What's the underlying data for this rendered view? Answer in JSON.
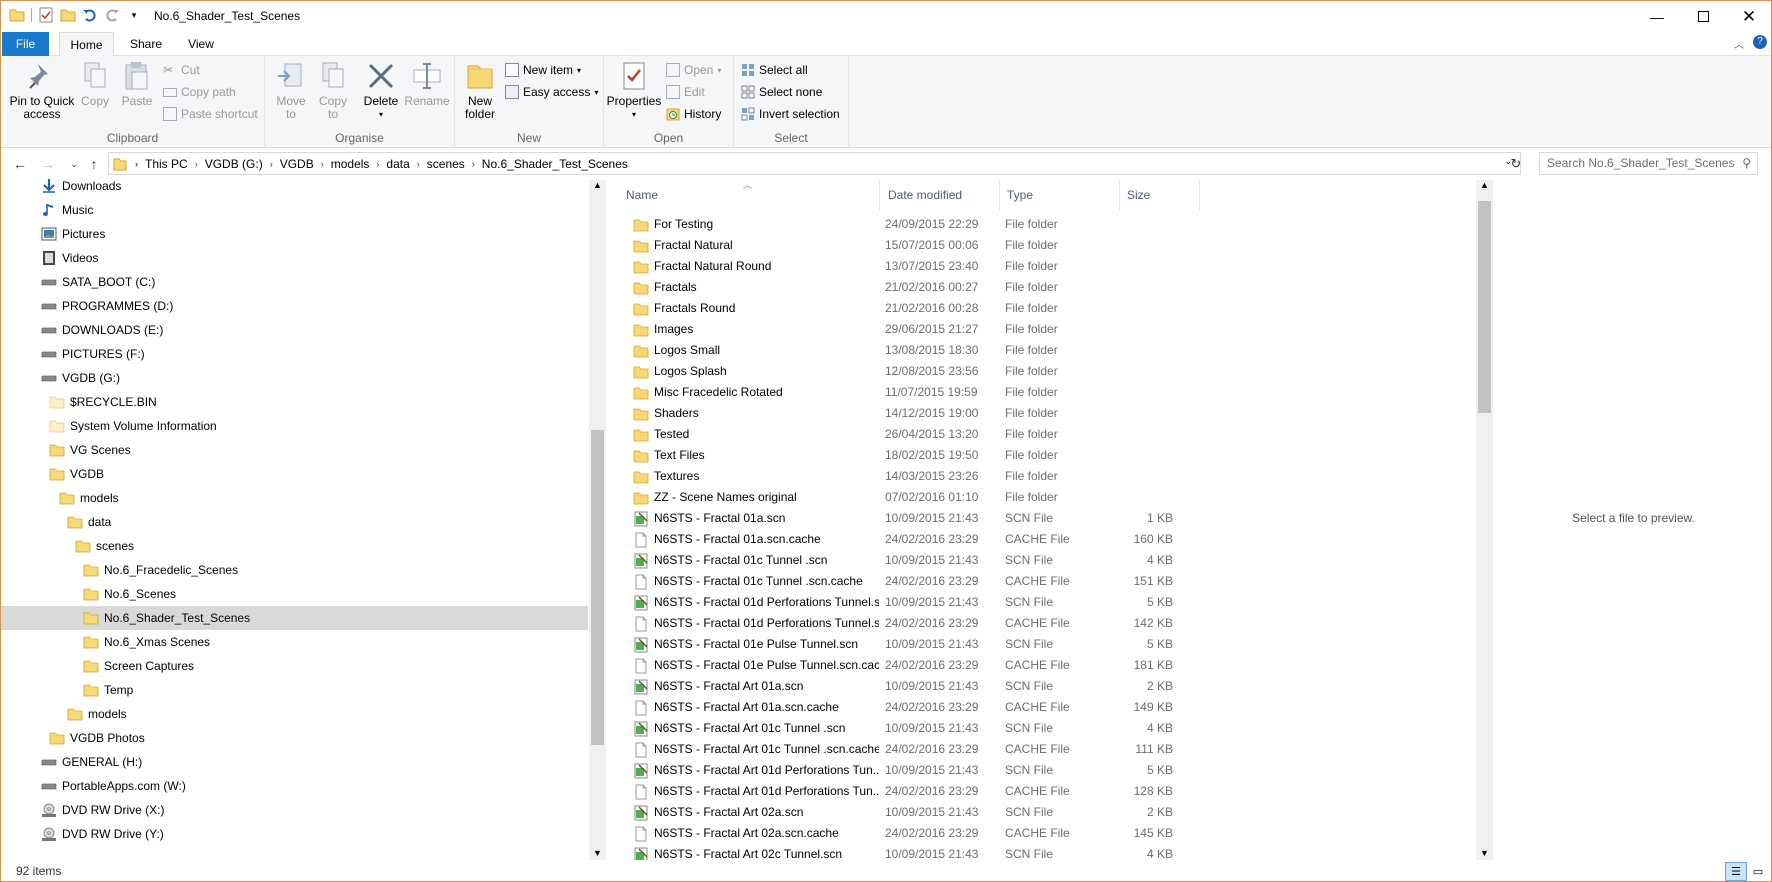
{
  "window": {
    "title": "No.6_Shader_Test_Scenes",
    "controls": [
      "minimize",
      "maximize",
      "close"
    ]
  },
  "quick_access_toolbar": {
    "icons": [
      "folder-icon",
      "properties-check-icon",
      "new-folder-icon",
      "undo-icon",
      "redo-icon",
      "customize-dropdown-icon"
    ]
  },
  "ribbon": {
    "tabs": [
      {
        "label": "File"
      },
      {
        "label": "Home"
      },
      {
        "label": "Share"
      },
      {
        "label": "View"
      }
    ],
    "active_tab": "Home",
    "groups": {
      "clipboard": {
        "label": "Clipboard",
        "pin_label": "Pin to Quick access",
        "pin_line1": "Pin to Quick",
        "pin_line2": "access",
        "copy_label": "Copy",
        "paste_label": "Paste",
        "cut_label": "Cut",
        "copy_path_label": "Copy path",
        "paste_shortcut_label": "Paste shortcut"
      },
      "organise": {
        "label": "Organise",
        "move_to_line1": "Move",
        "move_to_line2": "to",
        "copy_to_line1": "Copy",
        "copy_to_line2": "to",
        "delete_label": "Delete",
        "rename_label": "Rename"
      },
      "new": {
        "label": "New",
        "new_folder_line1": "New",
        "new_folder_line2": "folder",
        "new_item_label": "New item",
        "easy_access_label": "Easy access"
      },
      "open": {
        "label": "Open",
        "properties_label": "Properties",
        "open_label": "Open",
        "edit_label": "Edit",
        "history_label": "History"
      },
      "select": {
        "label": "Select",
        "select_all_label": "Select all",
        "select_none_label": "Select none",
        "invert_label": "Invert selection"
      }
    }
  },
  "address_bar": {
    "breadcrumbs": [
      "This PC",
      "VGDB (G:)",
      "VGDB",
      "models",
      "data",
      "scenes",
      "No.6_Shader_Test_Scenes"
    ],
    "search_placeholder": "Search No.6_Shader_Test_Scenes"
  },
  "nav_pane": {
    "items": [
      {
        "label": "Downloads",
        "icon": "downloads-icon",
        "level": 0
      },
      {
        "label": "Music",
        "icon": "music-icon",
        "level": 0
      },
      {
        "label": "Pictures",
        "icon": "pictures-icon",
        "level": 0
      },
      {
        "label": "Videos",
        "icon": "videos-icon",
        "level": 0
      },
      {
        "label": "SATA_BOOT (C:)",
        "icon": "drive-icon",
        "level": 0
      },
      {
        "label": "PROGRAMMES (D:)",
        "icon": "drive-icon",
        "level": 0
      },
      {
        "label": "DOWNLOADS (E:)",
        "icon": "drive-icon",
        "level": 0
      },
      {
        "label": "PICTURES (F:)",
        "icon": "drive-icon",
        "level": 0
      },
      {
        "label": "VGDB (G:)",
        "icon": "drive-icon",
        "level": 0
      },
      {
        "label": "$RECYCLE.BIN",
        "icon": "folder-pale-icon",
        "level": 1
      },
      {
        "label": "System Volume Information",
        "icon": "folder-pale-icon",
        "level": 1
      },
      {
        "label": "VG Scenes",
        "icon": "folder-icon",
        "level": 1
      },
      {
        "label": "VGDB",
        "icon": "folder-icon",
        "level": 1
      },
      {
        "label": "models",
        "icon": "folder-icon",
        "level": 2
      },
      {
        "label": "data",
        "icon": "folder-icon",
        "level": 3
      },
      {
        "label": "scenes",
        "icon": "folder-icon",
        "level": 4
      },
      {
        "label": "No.6_Fracedelic_Scenes",
        "icon": "folder-icon",
        "level": 5
      },
      {
        "label": "No.6_Scenes",
        "icon": "folder-icon",
        "level": 5
      },
      {
        "label": "No.6_Shader_Test_Scenes",
        "icon": "folder-icon",
        "level": 5,
        "selected": true
      },
      {
        "label": "No.6_Xmas Scenes",
        "icon": "folder-icon",
        "level": 5
      },
      {
        "label": "Screen Captures",
        "icon": "folder-icon",
        "level": 5
      },
      {
        "label": "Temp",
        "icon": "folder-icon",
        "level": 5
      },
      {
        "label": "models",
        "icon": "folder-icon",
        "level": 3
      },
      {
        "label": "VGDB Photos",
        "icon": "folder-icon",
        "level": 1
      },
      {
        "label": "GENERAL (H:)",
        "icon": "drive-icon",
        "level": 0
      },
      {
        "label": "PortableApps.com (W:)",
        "icon": "drive-icon",
        "level": 0
      },
      {
        "label": "DVD RW Drive (X:)",
        "icon": "dvd-icon",
        "level": 0
      },
      {
        "label": "DVD RW Drive (Y:)",
        "icon": "dvd-icon",
        "level": 0
      }
    ]
  },
  "file_list": {
    "columns": {
      "name": "Name",
      "date": "Date modified",
      "type": "Type",
      "size": "Size"
    },
    "rows": [
      {
        "name": "For Testing",
        "date": "24/09/2015 22:29",
        "type": "File folder",
        "size": "",
        "icon": "folder"
      },
      {
        "name": "Fractal Natural",
        "date": "15/07/2015 00:06",
        "type": "File folder",
        "size": "",
        "icon": "folder"
      },
      {
        "name": "Fractal Natural Round",
        "date": "13/07/2015 23:40",
        "type": "File folder",
        "size": "",
        "icon": "folder"
      },
      {
        "name": "Fractals",
        "date": "21/02/2016 00:27",
        "type": "File folder",
        "size": "",
        "icon": "folder"
      },
      {
        "name": "Fractals Round",
        "date": "21/02/2016 00:28",
        "type": "File folder",
        "size": "",
        "icon": "folder"
      },
      {
        "name": "Images",
        "date": "29/06/2015 21:27",
        "type": "File folder",
        "size": "",
        "icon": "folder"
      },
      {
        "name": "Logos Small",
        "date": "13/08/2015 18:30",
        "type": "File folder",
        "size": "",
        "icon": "folder"
      },
      {
        "name": "Logos Splash",
        "date": "12/08/2015 23:56",
        "type": "File folder",
        "size": "",
        "icon": "folder"
      },
      {
        "name": "Misc Fracedelic Rotated",
        "date": "11/07/2015 19:59",
        "type": "File folder",
        "size": "",
        "icon": "folder"
      },
      {
        "name": "Shaders",
        "date": "14/12/2015 19:00",
        "type": "File folder",
        "size": "",
        "icon": "folder"
      },
      {
        "name": "Tested",
        "date": "26/04/2015 13:20",
        "type": "File folder",
        "size": "",
        "icon": "folder"
      },
      {
        "name": "Text Files",
        "date": "18/02/2015 19:50",
        "type": "File folder",
        "size": "",
        "icon": "folder"
      },
      {
        "name": "Textures",
        "date": "14/03/2015 23:26",
        "type": "File folder",
        "size": "",
        "icon": "folder"
      },
      {
        "name": "ZZ - Scene Names original",
        "date": "07/02/2016 01:10",
        "type": "File folder",
        "size": "",
        "icon": "folder"
      },
      {
        "name": "N6STS - Fractal 01a.scn",
        "date": "10/09/2015 21:43",
        "type": "SCN File",
        "size": "1 KB",
        "icon": "scn"
      },
      {
        "name": "N6STS - Fractal 01a.scn.cache",
        "date": "24/02/2016 23:29",
        "type": "CACHE File",
        "size": "160 KB",
        "icon": "cache"
      },
      {
        "name": "N6STS - Fractal 01c Tunnel .scn",
        "date": "10/09/2015 21:43",
        "type": "SCN File",
        "size": "4 KB",
        "icon": "scn"
      },
      {
        "name": "N6STS - Fractal 01c Tunnel .scn.cache",
        "date": "24/02/2016 23:29",
        "type": "CACHE File",
        "size": "151 KB",
        "icon": "cache"
      },
      {
        "name": "N6STS - Fractal 01d Perforations Tunnel.s...",
        "date": "10/09/2015 21:43",
        "type": "SCN File",
        "size": "5 KB",
        "icon": "scn"
      },
      {
        "name": "N6STS - Fractal 01d Perforations Tunnel.s...",
        "date": "24/02/2016 23:29",
        "type": "CACHE File",
        "size": "142 KB",
        "icon": "cache"
      },
      {
        "name": "N6STS - Fractal 01e Pulse Tunnel.scn",
        "date": "10/09/2015 21:43",
        "type": "SCN File",
        "size": "5 KB",
        "icon": "scn"
      },
      {
        "name": "N6STS - Fractal 01e Pulse Tunnel.scn.cac...",
        "date": "24/02/2016 23:29",
        "type": "CACHE File",
        "size": "181 KB",
        "icon": "cache"
      },
      {
        "name": "N6STS - Fractal Art 01a.scn",
        "date": "10/09/2015 21:43",
        "type": "SCN File",
        "size": "2 KB",
        "icon": "scn"
      },
      {
        "name": "N6STS - Fractal Art 01a.scn.cache",
        "date": "24/02/2016 23:29",
        "type": "CACHE File",
        "size": "149 KB",
        "icon": "cache"
      },
      {
        "name": "N6STS - Fractal Art 01c Tunnel .scn",
        "date": "10/09/2015 21:43",
        "type": "SCN File",
        "size": "4 KB",
        "icon": "scn"
      },
      {
        "name": "N6STS - Fractal Art 01c Tunnel .scn.cache",
        "date": "24/02/2016 23:29",
        "type": "CACHE File",
        "size": "111 KB",
        "icon": "cache"
      },
      {
        "name": "N6STS - Fractal Art 01d Perforations Tun...",
        "date": "10/09/2015 21:43",
        "type": "SCN File",
        "size": "5 KB",
        "icon": "scn"
      },
      {
        "name": "N6STS - Fractal Art 01d Perforations Tun...",
        "date": "24/02/2016 23:29",
        "type": "CACHE File",
        "size": "128 KB",
        "icon": "cache"
      },
      {
        "name": "N6STS - Fractal Art 02a.scn",
        "date": "10/09/2015 21:43",
        "type": "SCN File",
        "size": "2 KB",
        "icon": "scn"
      },
      {
        "name": "N6STS - Fractal Art 02a.scn.cache",
        "date": "24/02/2016 23:29",
        "type": "CACHE File",
        "size": "145 KB",
        "icon": "cache"
      },
      {
        "name": "N6STS - Fractal Art 02c Tunnel.scn",
        "date": "10/09/2015 21:43",
        "type": "SCN File",
        "size": "4 KB",
        "icon": "scn"
      }
    ]
  },
  "preview_pane": {
    "message": "Select a file to preview."
  },
  "status_bar": {
    "item_count": "92 items"
  },
  "colors": {
    "file_tab": "#1979ca",
    "folder": "#f8d775",
    "selection": "#d9d9d9",
    "window_border": "#d8904c",
    "header_text": "#4c607a"
  }
}
